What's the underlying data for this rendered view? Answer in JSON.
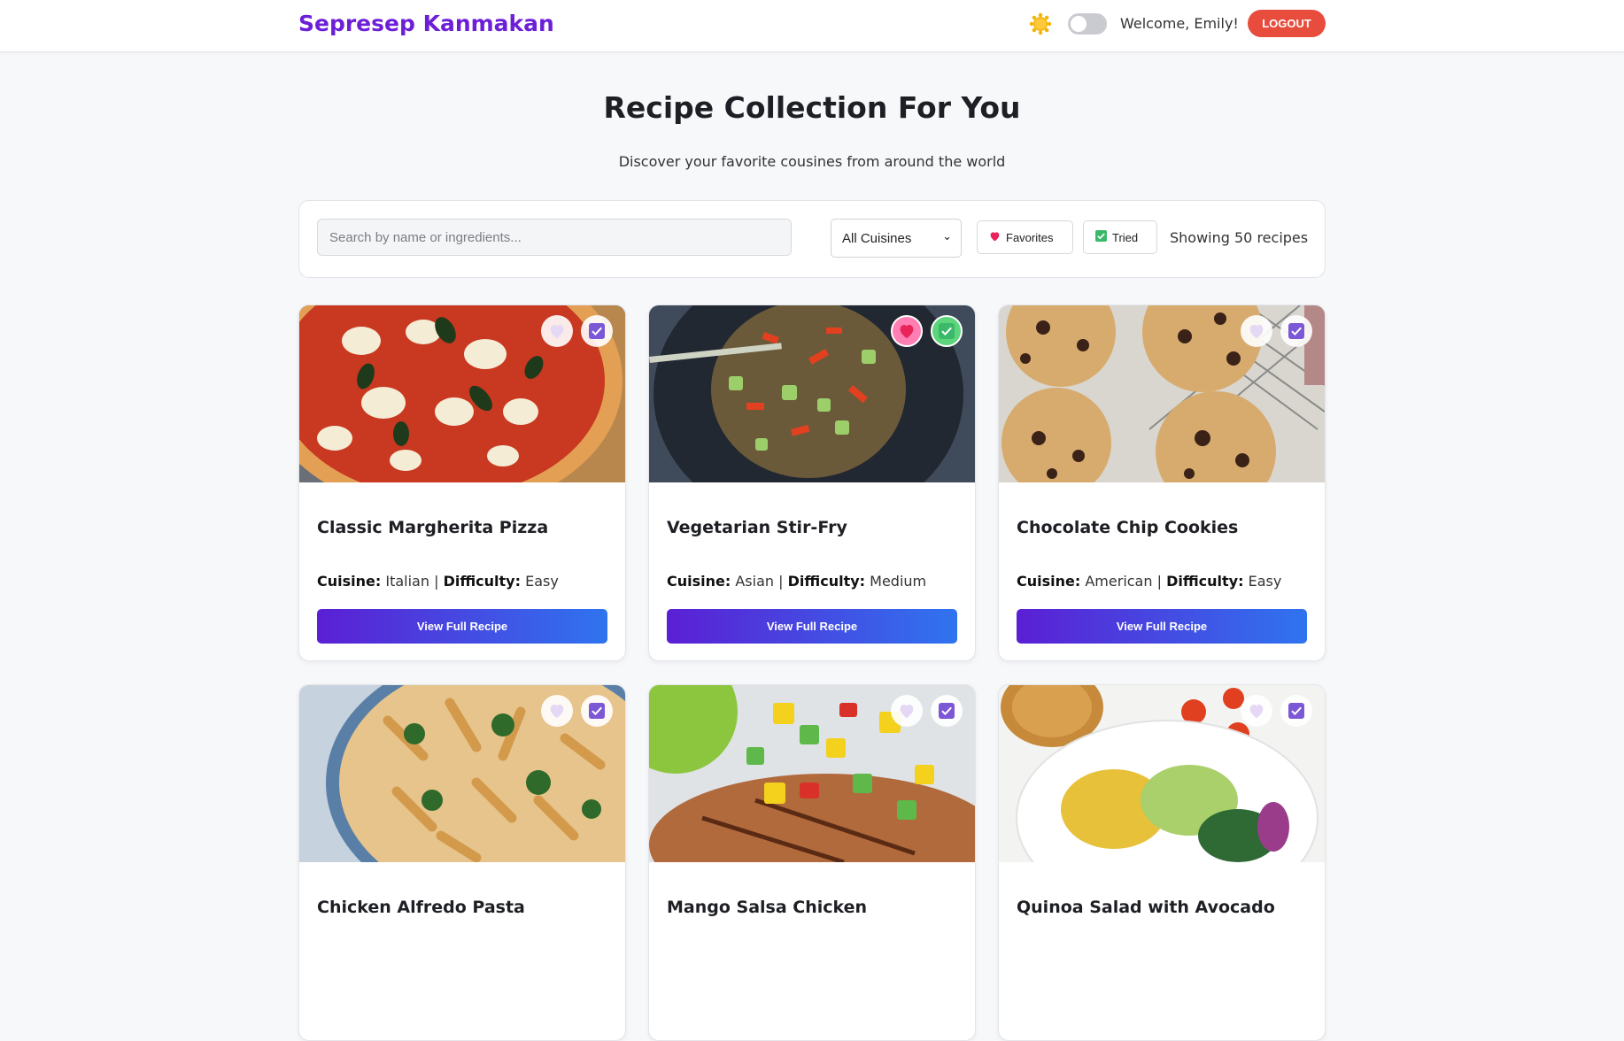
{
  "header": {
    "brand": "Sepresep Kanmakan",
    "welcome": "Welcome, Emily!",
    "logout_label": "LOGOUT"
  },
  "hero": {
    "title": "Recipe Collection For You",
    "subtitle": "Discover your favorite cousines from around the world"
  },
  "filters": {
    "search_placeholder": "Search by name or ingredients...",
    "cuisine_selected": "All Cuisines",
    "favorites_label": "Favorites",
    "tried_label": "Tried",
    "showing_text": "Showing 50 recipes"
  },
  "labels": {
    "cuisine": "Cuisine:",
    "difficulty": "Difficulty:",
    "view_button": "View Full Recipe"
  },
  "recipes": [
    {
      "title": "Classic Margherita Pizza",
      "cuisine": "Italian",
      "difficulty": "Easy",
      "favorite": false,
      "tried": false
    },
    {
      "title": "Vegetarian Stir-Fry",
      "cuisine": "Asian",
      "difficulty": "Medium",
      "favorite": true,
      "tried": true
    },
    {
      "title": "Chocolate Chip Cookies",
      "cuisine": "American",
      "difficulty": "Easy",
      "favorite": false,
      "tried": false
    },
    {
      "title": "Chicken Alfredo Pasta",
      "favorite": false,
      "tried": false
    },
    {
      "title": "Mango Salsa Chicken",
      "favorite": false,
      "tried": false
    },
    {
      "title": "Quinoa Salad with Avocado",
      "favorite": false,
      "tried": false
    }
  ],
  "colors": {
    "brand": "#6d1fd8",
    "logout": "#e74c3c",
    "button_gradient_start": "#5b1fd4",
    "button_gradient_end": "#2f74ef"
  }
}
